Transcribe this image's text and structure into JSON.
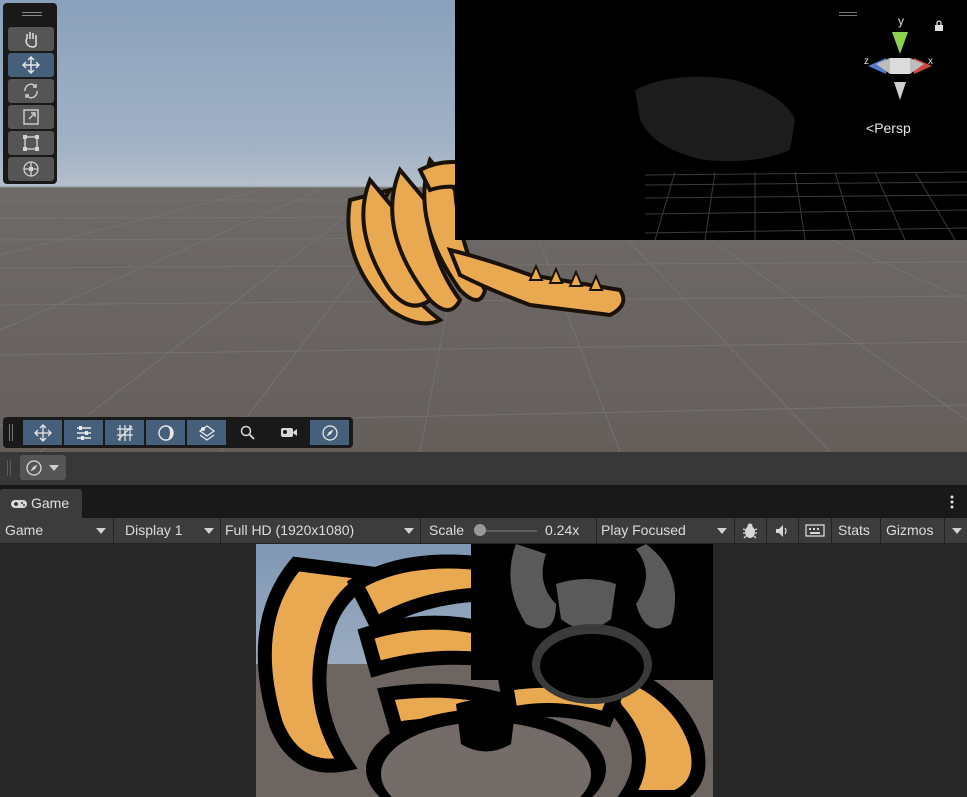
{
  "scene": {
    "gizmo": {
      "axis_y": "y",
      "axis_z": "z",
      "axis_x": "x",
      "persp_label": "Persp",
      "icons": [
        "lock-icon",
        "persp-arrow-icon"
      ]
    },
    "tool_palette": {
      "tools": [
        {
          "name": "hand-tool",
          "icon": "hand-icon",
          "active": false
        },
        {
          "name": "move-tool",
          "icon": "move-icon",
          "active": true
        },
        {
          "name": "rotate-tool",
          "icon": "rotate-icon",
          "active": false
        },
        {
          "name": "scale-tool",
          "icon": "scale-icon",
          "active": false
        },
        {
          "name": "rect-tool",
          "icon": "rect-icon",
          "active": false
        },
        {
          "name": "transform-tool",
          "icon": "transform-icon",
          "active": false
        }
      ]
    },
    "overlay_toolbar": {
      "buttons": [
        {
          "name": "move-overlay",
          "icon": "move-icon"
        },
        {
          "name": "tool-settings",
          "icon": "sliders-icon"
        },
        {
          "name": "grid-snap",
          "icon": "grid-snap-icon"
        },
        {
          "name": "shading",
          "icon": "moon-icon"
        },
        {
          "name": "orientation",
          "icon": "layers-icon"
        },
        {
          "name": "search",
          "icon": "search-icon"
        },
        {
          "name": "camera",
          "icon": "camera-icon"
        },
        {
          "name": "navigation",
          "icon": "compass-icon"
        }
      ]
    }
  },
  "mid_strip": {
    "nav_dropdown_icon": "compass-icon"
  },
  "game_panel": {
    "tab_label": "Game",
    "tab_icon": "gamepad-icon",
    "kebab_icon": "kebab-menu-icon",
    "toolbar": {
      "view_type": "Game",
      "display": "Display 1",
      "resolution": "Full HD (1920x1080)",
      "scale_label": "Scale",
      "scale_value": "0.24x",
      "scale_fraction": 0.0,
      "play_mode": "Play Focused",
      "stats_label": "Stats",
      "gizmos_label": "Gizmos",
      "icons": [
        "bug-icon",
        "audio-icon",
        "keyboard-icon"
      ]
    }
  },
  "colors": {
    "active_tool": "#46607c",
    "panel_bg": "#3c3c3c",
    "dark_bg": "#191919",
    "bone": "#e9a951"
  }
}
